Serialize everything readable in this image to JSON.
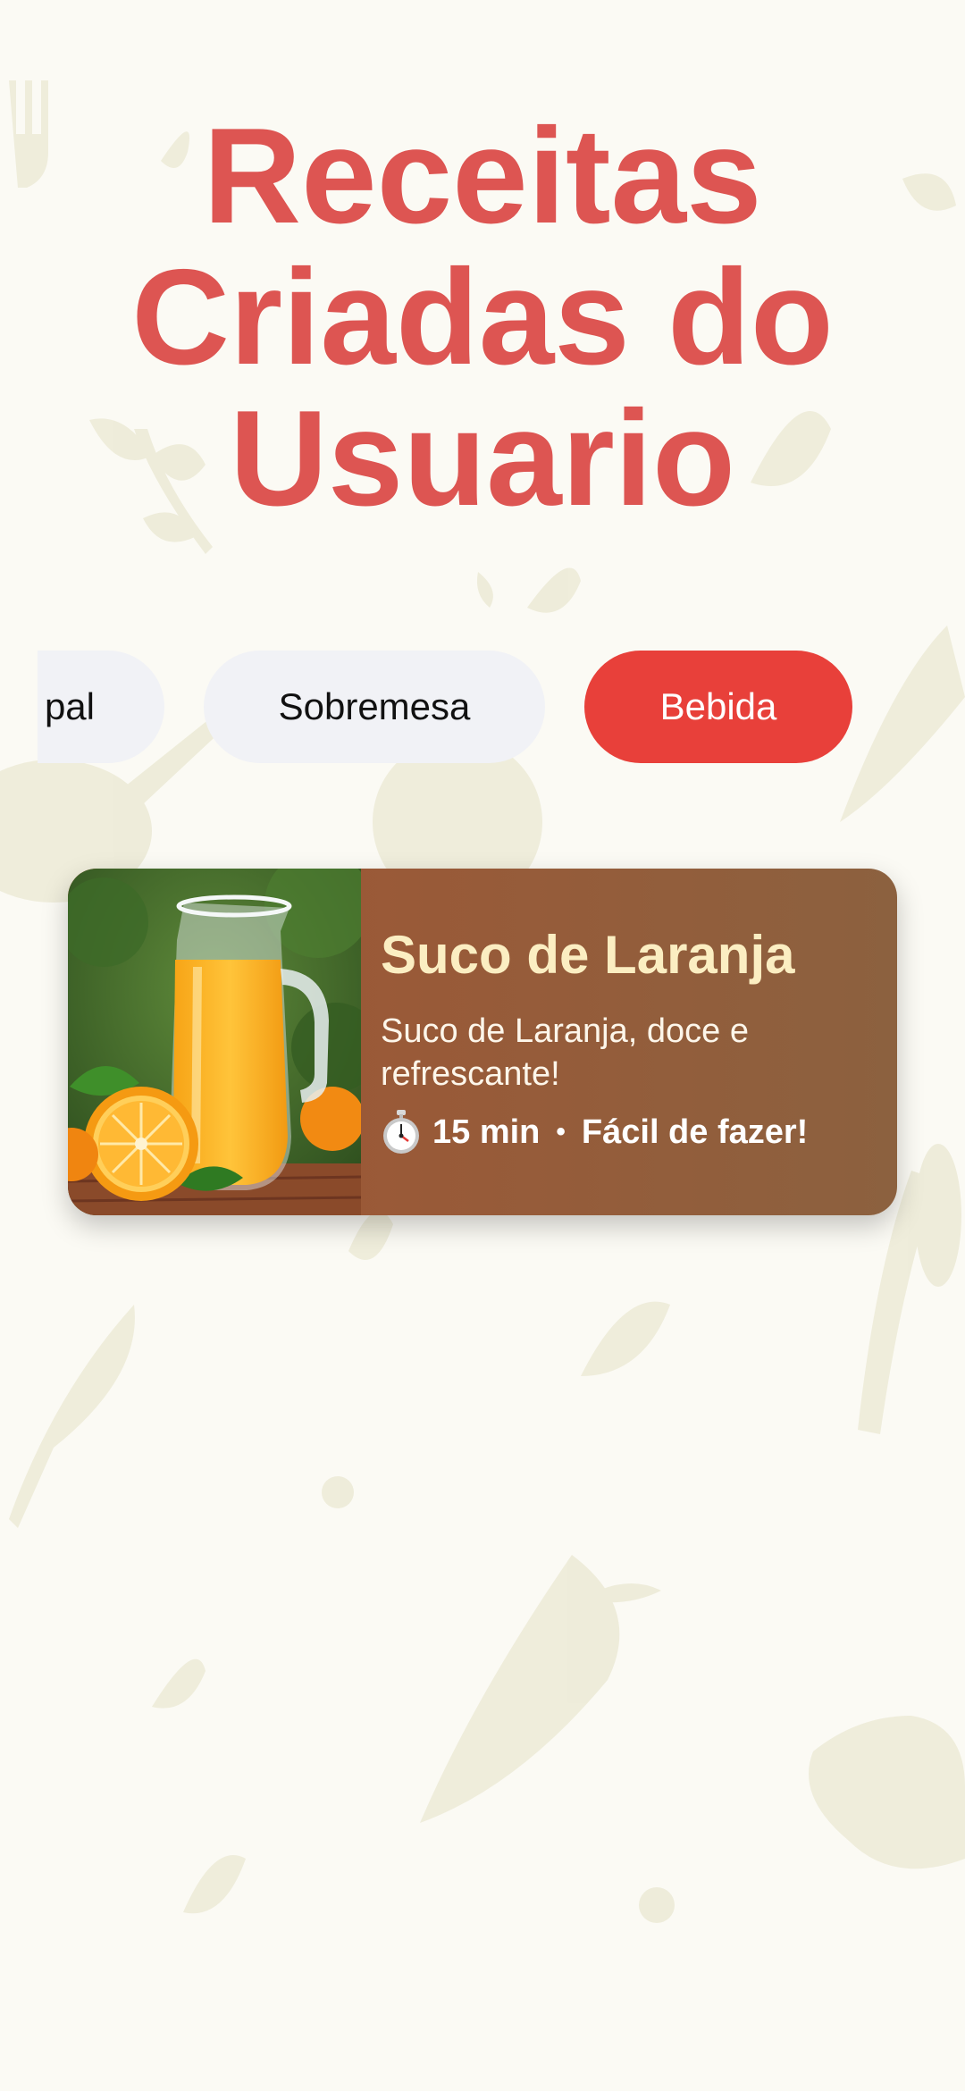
{
  "page": {
    "title_lines": [
      "Receitas",
      "Criadas do",
      "Usuario"
    ]
  },
  "categories": {
    "items": [
      {
        "label": "Principal",
        "visible_label": "pal",
        "selected": false
      },
      {
        "label": "Sobremesa",
        "visible_label": "Sobremesa",
        "selected": false
      },
      {
        "label": "Bebida",
        "visible_label": "Bebida",
        "selected": true
      }
    ]
  },
  "recipes": [
    {
      "title": "Suco de Laranja",
      "description": "Suco de Laranja, doce e refrescante!",
      "time": "15 min",
      "difficulty": "Fácil de fazer!",
      "time_icon": "stopwatch-icon"
    }
  ],
  "colors": {
    "title": "#dd5552",
    "selected_chip": "#e8403a",
    "chip": "#f1f2f6",
    "card_start": "#a25533",
    "card_end": "#8c613f",
    "card_title": "#fbeec2",
    "background": "#fbfaf4"
  }
}
